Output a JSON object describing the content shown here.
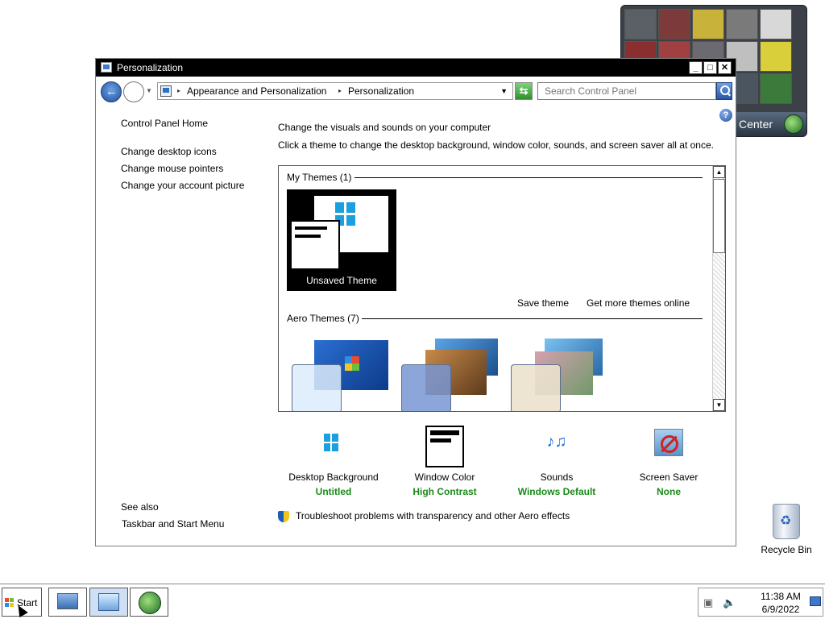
{
  "gadget": {
    "button_label": "Center"
  },
  "window": {
    "title": "Personalization",
    "controls": {
      "minimize": "_",
      "maximize": "□",
      "close": "✕"
    }
  },
  "address": {
    "crumbs": [
      "Appearance and Personalization",
      "Personalization"
    ],
    "search_placeholder": "Search Control Panel"
  },
  "help": "?",
  "left_pane": {
    "home": "Control Panel Home",
    "links": [
      "Change desktop icons",
      "Change mouse pointers",
      "Change your account picture"
    ],
    "see_also": "See also",
    "see_also_links": [
      "Taskbar and Start Menu"
    ]
  },
  "main": {
    "heading": "Change the visuals and sounds on your computer",
    "description": "Click a theme to change the desktop background, window color, sounds, and screen saver all at once.",
    "groups": {
      "my_themes": "My Themes (1)",
      "aero_themes": "Aero Themes (7)"
    },
    "unsaved_theme_label": "Unsaved Theme",
    "save_theme": "Save theme",
    "get_more": "Get more themes online",
    "scroll_up": "▲",
    "scroll_down": "▼"
  },
  "tiles": [
    {
      "name": "Desktop Background",
      "value": "Untitled",
      "icon": "desktop-background-icon"
    },
    {
      "name": "Window Color",
      "value": "High Contrast",
      "icon": "window-color-icon"
    },
    {
      "name": "Sounds",
      "value": "Windows Default",
      "icon": "sounds-icon"
    },
    {
      "name": "Screen Saver",
      "value": "None",
      "icon": "screen-saver-icon"
    }
  ],
  "troubleshoot": "Troubleshoot problems with transparency and other Aero effects",
  "desktop": {
    "recycle_bin": "Recycle Bin"
  },
  "taskbar": {
    "start": "Start",
    "time": "11:38 AM",
    "date": "6/9/2022"
  },
  "colors": {
    "accent_green": "#1a8a1a",
    "title_bar": "#000000"
  }
}
